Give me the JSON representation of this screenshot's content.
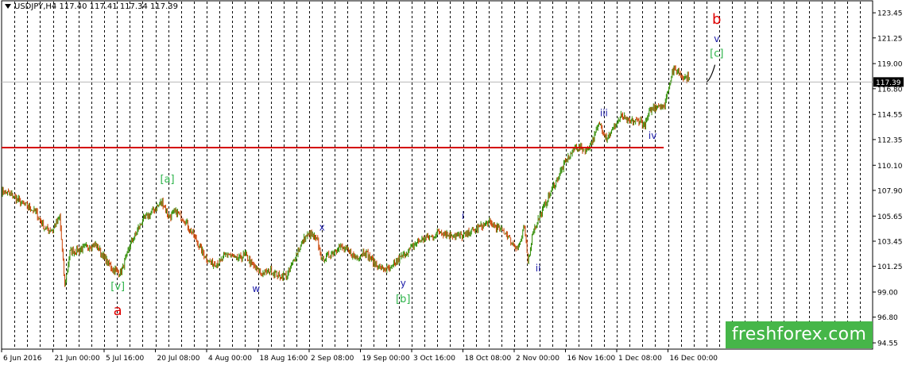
{
  "chart_data": {
    "type": "line",
    "title": "USDJPY,H4  117.40 117.41 117.34 117.39",
    "symbol": "USDJPY,H4",
    "ohlc": [
      "117.40",
      "117.41",
      "117.34",
      "117.39"
    ],
    "ylim": [
      94.0,
      124.5
    ],
    "y_ticks": [
      "123.45",
      "121.25",
      "119.00",
      "116.80",
      "114.55",
      "112.35",
      "110.10",
      "107.90",
      "105.65",
      "103.45",
      "101.25",
      "99.00",
      "96.80",
      "94.55"
    ],
    "current_price": "117.39",
    "x_ticks": [
      {
        "label": "6 Jun 2016",
        "i": 0
      },
      {
        "label": "21 Jun 00:00",
        "i": 60
      },
      {
        "label": "5 Jul 16:00",
        "i": 120
      },
      {
        "label": "20 Jul 08:00",
        "i": 180
      },
      {
        "label": "4 Aug 00:00",
        "i": 240
      },
      {
        "label": "18 Aug 16:00",
        "i": 300
      },
      {
        "label": "2 Sep 08:00",
        "i": 360
      },
      {
        "label": "19 Sep 00:00",
        "i": 420
      },
      {
        "label": "3 Oct 16:00",
        "i": 480
      },
      {
        "label": "18 Oct 08:00",
        "i": 540
      },
      {
        "label": "2 Nov 00:00",
        "i": 600
      },
      {
        "label": "16 Nov 16:00",
        "i": 660
      },
      {
        "label": "1 Dec 08:00",
        "i": 720
      },
      {
        "label": "16 Dec 00:00",
        "i": 780
      }
    ],
    "n_bars": 805,
    "price_path": [
      {
        "i": 0,
        "p": 107.8
      },
      {
        "i": 10,
        "p": 107.6
      },
      {
        "i": 20,
        "p": 107.0
      },
      {
        "i": 30,
        "p": 106.5
      },
      {
        "i": 40,
        "p": 106.0
      },
      {
        "i": 50,
        "p": 104.6
      },
      {
        "i": 60,
        "p": 104.4
      },
      {
        "i": 68,
        "p": 105.6
      },
      {
        "i": 74,
        "p": 99.5
      },
      {
        "i": 80,
        "p": 102.5
      },
      {
        "i": 95,
        "p": 102.8
      },
      {
        "i": 110,
        "p": 103.2
      },
      {
        "i": 120,
        "p": 102.0
      },
      {
        "i": 130,
        "p": 101.0
      },
      {
        "i": 140,
        "p": 100.7
      },
      {
        "i": 150,
        "p": 103.0
      },
      {
        "i": 165,
        "p": 105.3
      },
      {
        "i": 180,
        "p": 106.3
      },
      {
        "i": 188,
        "p": 106.9
      },
      {
        "i": 196,
        "p": 105.6
      },
      {
        "i": 205,
        "p": 106.0
      },
      {
        "i": 215,
        "p": 105.2
      },
      {
        "i": 225,
        "p": 103.9
      },
      {
        "i": 235,
        "p": 102.5
      },
      {
        "i": 245,
        "p": 101.5
      },
      {
        "i": 255,
        "p": 101.6
      },
      {
        "i": 265,
        "p": 102.4
      },
      {
        "i": 275,
        "p": 101.8
      },
      {
        "i": 285,
        "p": 102.3
      },
      {
        "i": 295,
        "p": 101.2
      },
      {
        "i": 305,
        "p": 100.6
      },
      {
        "i": 315,
        "p": 100.9
      },
      {
        "i": 325,
        "p": 100.4
      },
      {
        "i": 335,
        "p": 100.5
      },
      {
        "i": 345,
        "p": 102.3
      },
      {
        "i": 355,
        "p": 103.8
      },
      {
        "i": 362,
        "p": 104.1
      },
      {
        "i": 370,
        "p": 103.4
      },
      {
        "i": 375,
        "p": 101.8
      },
      {
        "i": 385,
        "p": 102.3
      },
      {
        "i": 395,
        "p": 103.0
      },
      {
        "i": 405,
        "p": 102.6
      },
      {
        "i": 415,
        "p": 102.0
      },
      {
        "i": 425,
        "p": 102.6
      },
      {
        "i": 435,
        "p": 101.6
      },
      {
        "i": 445,
        "p": 101.0
      },
      {
        "i": 455,
        "p": 101.0
      },
      {
        "i": 465,
        "p": 101.9
      },
      {
        "i": 475,
        "p": 102.5
      },
      {
        "i": 485,
        "p": 103.3
      },
      {
        "i": 495,
        "p": 103.7
      },
      {
        "i": 505,
        "p": 103.9
      },
      {
        "i": 512,
        "p": 104.3
      },
      {
        "i": 525,
        "p": 104.0
      },
      {
        "i": 540,
        "p": 103.9
      },
      {
        "i": 555,
        "p": 104.5
      },
      {
        "i": 570,
        "p": 105.1
      },
      {
        "i": 580,
        "p": 104.6
      },
      {
        "i": 590,
        "p": 104.2
      },
      {
        "i": 598,
        "p": 103.2
      },
      {
        "i": 605,
        "p": 102.9
      },
      {
        "i": 612,
        "p": 104.6
      },
      {
        "i": 616,
        "p": 101.6
      },
      {
        "i": 622,
        "p": 104.3
      },
      {
        "i": 632,
        "p": 106.0
      },
      {
        "i": 645,
        "p": 108.1
      },
      {
        "i": 660,
        "p": 110.4
      },
      {
        "i": 672,
        "p": 111.7
      },
      {
        "i": 685,
        "p": 111.4
      },
      {
        "i": 693,
        "p": 112.5
      },
      {
        "i": 700,
        "p": 113.8
      },
      {
        "i": 708,
        "p": 112.5
      },
      {
        "i": 716,
        "p": 113.3
      },
      {
        "i": 725,
        "p": 114.4
      },
      {
        "i": 735,
        "p": 113.9
      },
      {
        "i": 748,
        "p": 114.0
      },
      {
        "i": 752,
        "p": 113.5
      },
      {
        "i": 760,
        "p": 115.0
      },
      {
        "i": 768,
        "p": 115.4
      },
      {
        "i": 775,
        "p": 115.2
      },
      {
        "i": 780,
        "p": 116.7
      },
      {
        "i": 785,
        "p": 118.3
      },
      {
        "i": 790,
        "p": 118.4
      },
      {
        "i": 800,
        "p": 117.8
      },
      {
        "i": 810,
        "p": 117.8
      },
      {
        "i": 820,
        "p": 117.3
      },
      {
        "i": 825,
        "p": 117.4
      }
    ],
    "projection": [
      {
        "i": 825,
        "p": 117.39
      },
      {
        "i": 830,
        "p": 117.6
      },
      {
        "i": 835,
        "p": 118.9
      }
    ],
    "support_line": {
      "price": 111.65,
      "from_i": 0,
      "to_i": 775,
      "color": "#d40000"
    },
    "annotations": [
      {
        "text": "[v]",
        "i": 136,
        "p": 99.2,
        "color": "#2db34a",
        "size": 13
      },
      {
        "text": "a",
        "i": 136,
        "p": 97.0,
        "color": "#e00000",
        "size": 18
      },
      {
        "text": "[a]",
        "i": 194,
        "p": 108.6,
        "color": "#2db34a",
        "size": 13
      },
      {
        "text": "w",
        "i": 298,
        "p": 99.0,
        "color": "#1a1aa8",
        "size": 12
      },
      {
        "text": "x",
        "i": 375,
        "p": 104.4,
        "color": "#1a1aa8",
        "size": 12
      },
      {
        "text": "y",
        "i": 470,
        "p": 99.5,
        "color": "#1a1aa8",
        "size": 12
      },
      {
        "text": "[b]",
        "i": 470,
        "p": 98.1,
        "color": "#2db34a",
        "size": 13
      },
      {
        "text": "i",
        "i": 540,
        "p": 105.4,
        "color": "#1a1aa8",
        "size": 12
      },
      {
        "text": "ii",
        "i": 628,
        "p": 100.8,
        "color": "#1a1aa8",
        "size": 12
      },
      {
        "text": "iii",
        "i": 705,
        "p": 114.4,
        "color": "#1a1aa8",
        "size": 12
      },
      {
        "text": "iv",
        "i": 762,
        "p": 112.4,
        "color": "#1a1aa8",
        "size": 12
      },
      {
        "text": "b",
        "i": 837,
        "p": 122.5,
        "color": "#e00000",
        "size": 18
      },
      {
        "text": "v",
        "i": 837,
        "p": 120.9,
        "color": "#1a1aa8",
        "size": 12
      },
      {
        "text": "[c]",
        "i": 837,
        "p": 119.6,
        "color": "#2db34a",
        "size": 13
      }
    ],
    "colors": {
      "bull": "#2e8b00",
      "bear": "#c84000",
      "frame": "#000000",
      "grid": "#000000",
      "price_badge": "#000000"
    }
  },
  "watermark": "freshforex.com"
}
